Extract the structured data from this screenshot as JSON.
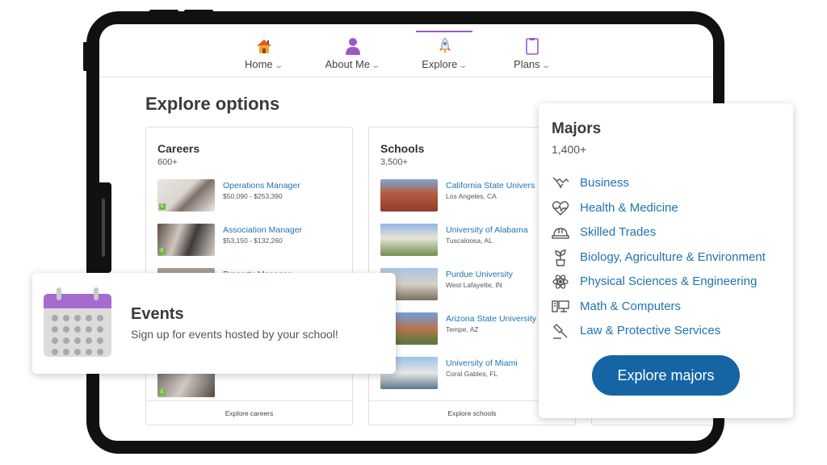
{
  "nav": {
    "items": [
      {
        "label": "Home",
        "icon": "house-icon"
      },
      {
        "label": "About Me",
        "icon": "person-icon"
      },
      {
        "label": "Explore",
        "icon": "rocket-icon"
      },
      {
        "label": "Plans",
        "icon": "clipboard-icon"
      }
    ],
    "active": "Explore",
    "accent_color": "#9b59c8"
  },
  "page_title": "Explore options",
  "careers": {
    "title": "Careers",
    "count": "600+",
    "items": [
      {
        "title": "Operations Manager",
        "sub": "$50,090 - $253,390",
        "badge": "E"
      },
      {
        "title": "Association Manager",
        "sub": "$53,150 - $132,260",
        "badge": "E"
      },
      {
        "title": "Property Manager",
        "sub": ""
      },
      {
        "title": "",
        "sub": "",
        "badge": "E"
      }
    ],
    "footer": "Explore careers"
  },
  "schools": {
    "title": "Schools",
    "count": "3,500+",
    "items": [
      {
        "title": "California State Univers",
        "sub": "Los Angeles, CA"
      },
      {
        "title": "University of Alabama",
        "sub": "Tuscaloosa, AL"
      },
      {
        "title": "Purdue University",
        "sub": "West Lafayette, IN"
      },
      {
        "title": "Arizona State University",
        "sub": "Tempe, AZ"
      },
      {
        "title": "University of Miami",
        "sub": "Coral Gables, FL"
      }
    ],
    "footer": "Explore schools"
  },
  "events": {
    "title": "Events",
    "subtitle": "Sign up for events hosted by your school!",
    "icon": "calendar-icon"
  },
  "majors": {
    "title": "Majors",
    "count": "1,400+",
    "items": [
      {
        "label": "Business",
        "icon": "handshake-icon"
      },
      {
        "label": "Health & Medicine",
        "icon": "heartbeat-icon"
      },
      {
        "label": "Skilled Trades",
        "icon": "hardhat-icon"
      },
      {
        "label": "Biology, Agriculture & Environment",
        "icon": "plant-icon"
      },
      {
        "label": "Physical Sciences & Engineering",
        "icon": "atom-icon"
      },
      {
        "label": "Math & Computers",
        "icon": "computer-icon"
      },
      {
        "label": "Law & Protective Services",
        "icon": "gavel-icon"
      }
    ],
    "button": "Explore majors",
    "button_color": "#1565a4"
  },
  "colors": {
    "link": "#1e73b3",
    "badge_green": "#6cbb3c"
  }
}
